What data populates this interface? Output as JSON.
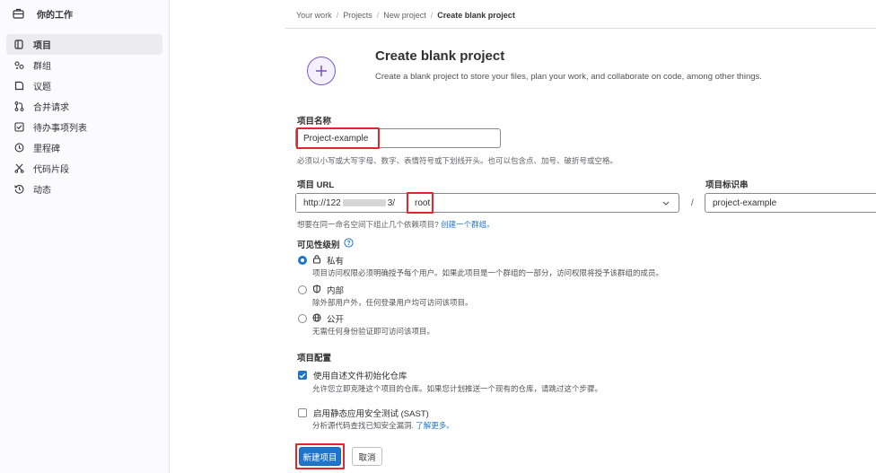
{
  "sidebar": {
    "header": "你的工作",
    "items": [
      {
        "label": "项目",
        "icon": "project-icon",
        "active": true
      },
      {
        "label": "群组",
        "icon": "group-icon"
      },
      {
        "label": "议题",
        "icon": "issues-icon"
      },
      {
        "label": "合并请求",
        "icon": "merge-request-icon"
      },
      {
        "label": "待办事项列表",
        "icon": "todo-icon"
      },
      {
        "label": "里程碑",
        "icon": "milestone-icon"
      },
      {
        "label": "代码片段",
        "icon": "snippet-icon"
      },
      {
        "label": "动态",
        "icon": "activity-icon"
      }
    ]
  },
  "breadcrumb": [
    "Your work",
    "Projects",
    "New project",
    "Create blank project"
  ],
  "header": {
    "title": "Create blank project",
    "description": "Create a blank project to store your files, plan your work, and collaborate on code, among other things."
  },
  "form": {
    "project_name_label": "项目名称",
    "project_name_value": "Project-example",
    "project_name_help": "必须以小写或大写字母、数字、表情符号或下划线开头。也可以包含点、加号、破折号或空格。",
    "project_url_label": "项目 URL",
    "url_prefix_start": "http://122",
    "url_prefix_end": "3/",
    "namespace_value": "root",
    "slug_label": "项目标识串",
    "slug_value": "project-example",
    "group_help_prefix": "想要在同一命名空间下组止几个依赖项目?",
    "group_help_link": "创建一个群组。",
    "visibility_label": "可见性级别",
    "visibility_options": [
      {
        "label": "私有",
        "desc": "项目访问权限必须明确授予每个用户。如果此项目是一个群组的一部分，访问权限将授予该群组的成员。",
        "checked": true,
        "icon": "lock-icon"
      },
      {
        "label": "内部",
        "desc": "除外部用户外，任何登录用户均可访问该项目。",
        "checked": false,
        "icon": "shield-icon"
      },
      {
        "label": "公开",
        "desc": "无需任何身份验证即可访问该项目。",
        "checked": false,
        "icon": "globe-icon"
      }
    ],
    "config_label": "项目配置",
    "config_options": [
      {
        "label": "使用自述文件初始化仓库",
        "desc": "允许您立即克隆这个项目的仓库。如果您计划推送一个现有的仓库，请跳过这个步骤。",
        "checked": true
      },
      {
        "label": "启用静态应用安全测试 (SAST)",
        "desc_prefix": "分析源代码查找已知安全漏洞.",
        "desc_link": "了解更多。",
        "checked": false
      }
    ],
    "submit_label": "新建项目",
    "cancel_label": "取消"
  },
  "colors": {
    "accent": "#1f75cb",
    "highlight": "#e3262e",
    "brand": "#7b58cf"
  }
}
